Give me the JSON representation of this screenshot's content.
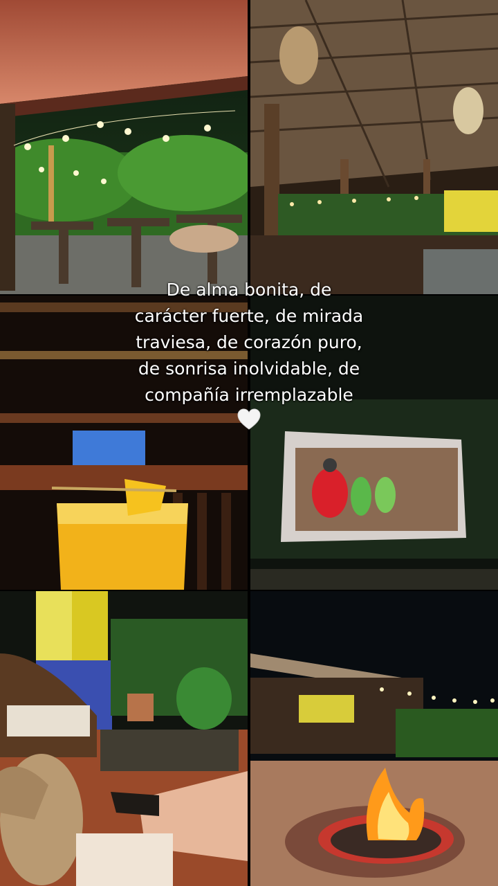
{
  "caption": {
    "lines": [
      "De alma bonita, de",
      "carácter fuerte, de mirada",
      "traviesa, de corazón puro,",
      "de sonrisa inolvidable, de",
      "compañía irremplazable"
    ],
    "emoji": "white-heart-icon"
  },
  "photos": [
    {
      "subject": "garden-patio-night"
    },
    {
      "subject": "thatched-terrace-restaurant"
    },
    {
      "subject": "orange-cocktail"
    },
    {
      "subject": "outdoor-cinema-screen"
    },
    {
      "subject": "patio-with-dog-and-feet"
    },
    {
      "subject": "bonfire-at-night"
    }
  ],
  "colors": {
    "background": "#000000",
    "caption_text": "#ffffff"
  }
}
